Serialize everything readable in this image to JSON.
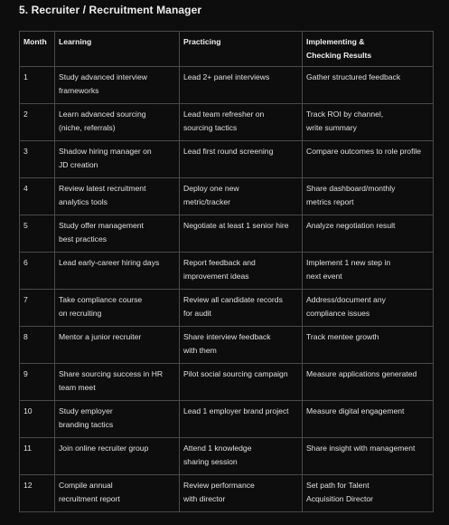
{
  "heading": "5. Recruiter / Recruitment Manager",
  "table": {
    "columns": [
      "Month",
      "Learning",
      "Practicing",
      "Implementing &\nChecking Results"
    ],
    "rows": [
      {
        "month": "1",
        "learning": "Study advanced interview\nframeworks",
        "practicing": "Lead 2+ panel interviews",
        "implementing": "Gather structured feedback"
      },
      {
        "month": "2",
        "learning": "Learn advanced sourcing\n(niche, referrals)",
        "practicing": "Lead team refresher on\nsourcing tactics",
        "implementing": "Track ROI by channel,\nwrite summary"
      },
      {
        "month": "3",
        "learning": "Shadow hiring manager on\nJD creation",
        "practicing": "Lead first round screening",
        "implementing": "Compare outcomes to role profile"
      },
      {
        "month": "4",
        "learning": "Review latest recruitment\nanalytics tools",
        "practicing": "Deploy one new\nmetric/tracker",
        "implementing": "Share dashboard/monthly\nmetrics report"
      },
      {
        "month": "5",
        "learning": "Study offer management\nbest practices",
        "practicing": "Negotiate at least 1 senior hire",
        "implementing": "Analyze negotiation result"
      },
      {
        "month": "6",
        "learning": "Lead early-career hiring days",
        "practicing": "Report feedback and\nimprovement ideas",
        "implementing": "Implement 1 new step in\nnext event"
      },
      {
        "month": "7",
        "learning": "Take compliance course\non recruiting",
        "practicing": "Review all candidate records\nfor audit",
        "implementing": "Address/document any\ncompliance issues"
      },
      {
        "month": "8",
        "learning": "Mentor a junior recruiter",
        "practicing": "Share interview feedback\nwith them",
        "implementing": "Track mentee growth"
      },
      {
        "month": "9",
        "learning": "Share sourcing success in HR\nteam meet",
        "practicing": "Pilot social sourcing campaign",
        "implementing": "Measure applications generated"
      },
      {
        "month": "10",
        "learning": "Study employer\nbranding tactics",
        "practicing": "Lead 1 employer brand project",
        "implementing": "Measure digital engagement"
      },
      {
        "month": "11",
        "learning": "Join online recruiter group",
        "practicing": "Attend 1 knowledge\nsharing session",
        "implementing": "Share insight with management"
      },
      {
        "month": "12",
        "learning": "Compile annual\nrecruitment report",
        "practicing": "Review performance\nwith director",
        "implementing": "Set path for Talent\nAcquisition Director"
      }
    ]
  }
}
